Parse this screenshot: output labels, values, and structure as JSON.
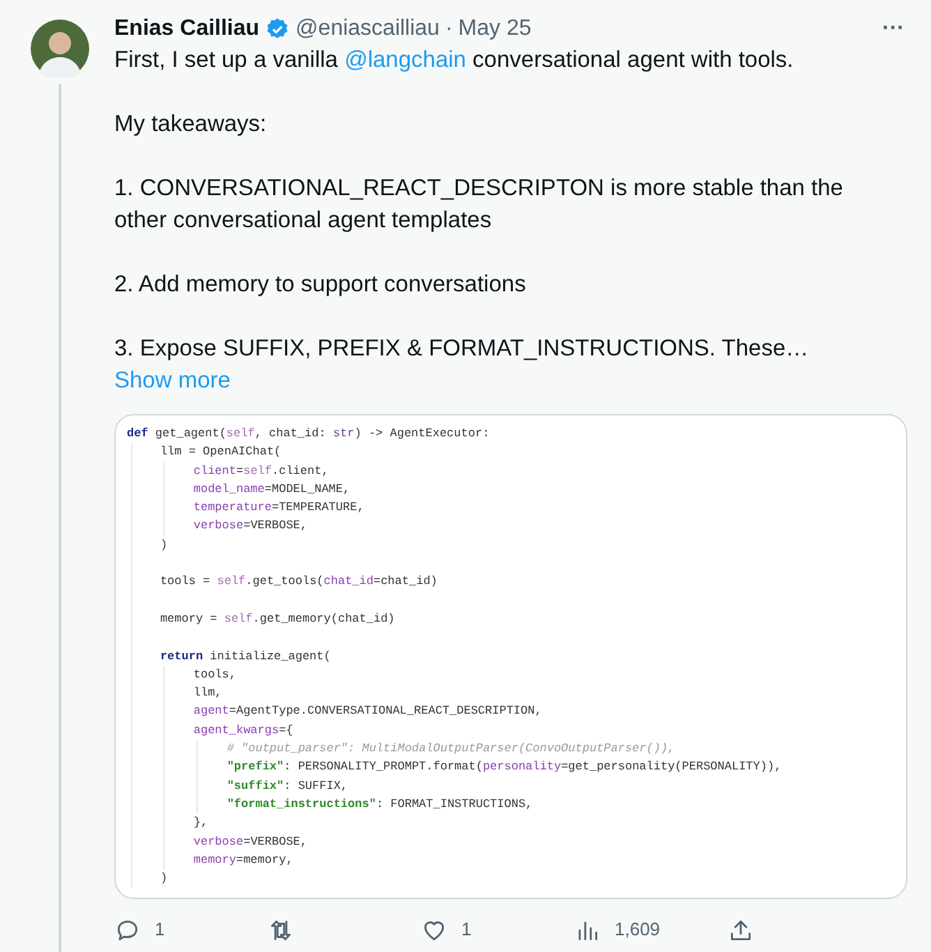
{
  "author": {
    "name": "Enias Cailliau",
    "verified": true,
    "handle": "@eniascailliau",
    "separator": "·",
    "date": "May 25"
  },
  "more_menu": "···",
  "paragraphs": [
    [
      {
        "kind": "text",
        "text": "First, I set up a vanilla "
      },
      {
        "kind": "link",
        "text": "@langchain"
      },
      {
        "kind": "text",
        "text": " conversational agent with tools."
      }
    ],
    [
      {
        "kind": "text",
        "text": "My takeaways:"
      }
    ],
    [
      {
        "kind": "text",
        "text": "1. CONVERSATIONAL_REACT_DESCRIPTON is more stable than the other conversational agent templates"
      }
    ],
    [
      {
        "kind": "text",
        "text": "2. Add memory to support conversations"
      }
    ],
    [
      {
        "kind": "text",
        "text": "3. Expose SUFFIX, PREFIX & FORMAT_INSTRUCTIONS. These…"
      },
      {
        "kind": "link",
        "text": "Show more"
      }
    ]
  ],
  "code_lines": [
    {
      "tokens": [
        {
          "kind": "keyword",
          "text": "def"
        },
        {
          "kind": "plain",
          "text": " get_agent("
        },
        {
          "kind": "self",
          "text": "self"
        },
        {
          "kind": "plain",
          "text": ", chat_id: "
        },
        {
          "kind": "builtin",
          "text": "str"
        },
        {
          "kind": "plain",
          "text": ") -> AgentExecutor:"
        }
      ],
      "children": [
        {
          "tokens": [
            {
              "kind": "plain",
              "text": "llm = OpenAIChat("
            }
          ],
          "children": [
            {
              "tokens": [
                {
                  "kind": "param",
                  "text": "client"
                },
                {
                  "kind": "plain",
                  "text": "="
                },
                {
                  "kind": "self",
                  "text": "self"
                },
                {
                  "kind": "plain",
                  "text": ".client,"
                }
              ]
            },
            {
              "tokens": [
                {
                  "kind": "param",
                  "text": "model_name"
                },
                {
                  "kind": "plain",
                  "text": "=MODEL_NAME,"
                }
              ]
            },
            {
              "tokens": [
                {
                  "kind": "param",
                  "text": "temperature"
                },
                {
                  "kind": "plain",
                  "text": "=TEMPERATURE,"
                }
              ]
            },
            {
              "tokens": [
                {
                  "kind": "param",
                  "text": "verbose"
                },
                {
                  "kind": "plain",
                  "text": "=VERBOSE,"
                }
              ]
            }
          ]
        },
        {
          "tokens": [
            {
              "kind": "plain",
              "text": ")"
            }
          ],
          "blank_after": true
        },
        {
          "tokens": [
            {
              "kind": "plain",
              "text": "tools = "
            },
            {
              "kind": "self",
              "text": "self"
            },
            {
              "kind": "plain",
              "text": ".get_tools("
            },
            {
              "kind": "param",
              "text": "chat_id"
            },
            {
              "kind": "plain",
              "text": "=chat_id)"
            }
          ],
          "blank_after": true
        },
        {
          "tokens": [
            {
              "kind": "plain",
              "text": "memory = "
            },
            {
              "kind": "self",
              "text": "self"
            },
            {
              "kind": "plain",
              "text": ".get_memory(chat_id)"
            }
          ],
          "blank_after": true
        },
        {
          "tokens": [
            {
              "kind": "keyword",
              "text": "return"
            },
            {
              "kind": "plain",
              "text": " initialize_agent("
            }
          ],
          "children": [
            {
              "tokens": [
                {
                  "kind": "plain",
                  "text": "tools,"
                }
              ]
            },
            {
              "tokens": [
                {
                  "kind": "plain",
                  "text": "llm,"
                }
              ]
            },
            {
              "tokens": [
                {
                  "kind": "param",
                  "text": "agent"
                },
                {
                  "kind": "plain",
                  "text": "=AgentType.CONVERSATIONAL_REACT_DESCRIPTION,"
                }
              ]
            },
            {
              "tokens": [
                {
                  "kind": "param",
                  "text": "agent_kwargs"
                },
                {
                  "kind": "plain",
                  "text": "={"
                }
              ],
              "children": [
                {
                  "tokens": [
                    {
                      "kind": "comment",
                      "text": "# \"output_parser\": MultiModalOutputParser(ConvoOutputParser()),"
                    }
                  ]
                },
                {
                  "tokens": [
                    {
                      "kind": "string",
                      "text": "\"prefix\""
                    },
                    {
                      "kind": "plain",
                      "text": ": PERSONALITY_PROMPT.format("
                    },
                    {
                      "kind": "param",
                      "text": "personality"
                    },
                    {
                      "kind": "plain",
                      "text": "=get_personality(PERSONALITY)),"
                    }
                  ]
                },
                {
                  "tokens": [
                    {
                      "kind": "string",
                      "text": "\"suffix\""
                    },
                    {
                      "kind": "plain",
                      "text": ": SUFFIX,"
                    }
                  ]
                },
                {
                  "tokens": [
                    {
                      "kind": "string",
                      "text": "\"format_instructions\""
                    },
                    {
                      "kind": "plain",
                      "text": ": FORMAT_INSTRUCTIONS,"
                    }
                  ]
                }
              ]
            },
            {
              "tokens": [
                {
                  "kind": "plain",
                  "text": "},"
                }
              ]
            },
            {
              "tokens": [
                {
                  "kind": "param",
                  "text": "verbose"
                },
                {
                  "kind": "plain",
                  "text": "=VERBOSE,"
                }
              ]
            },
            {
              "tokens": [
                {
                  "kind": "param",
                  "text": "memory"
                },
                {
                  "kind": "plain",
                  "text": "=memory,"
                }
              ]
            }
          ]
        },
        {
          "tokens": [
            {
              "kind": "plain",
              "text": ")"
            }
          ]
        }
      ]
    }
  ],
  "actions": [
    {
      "kind": "reply",
      "count": "1"
    },
    {
      "kind": "repost"
    },
    {
      "kind": "like",
      "count": "1"
    },
    {
      "kind": "views",
      "count": "1,609"
    },
    {
      "kind": "share"
    }
  ]
}
